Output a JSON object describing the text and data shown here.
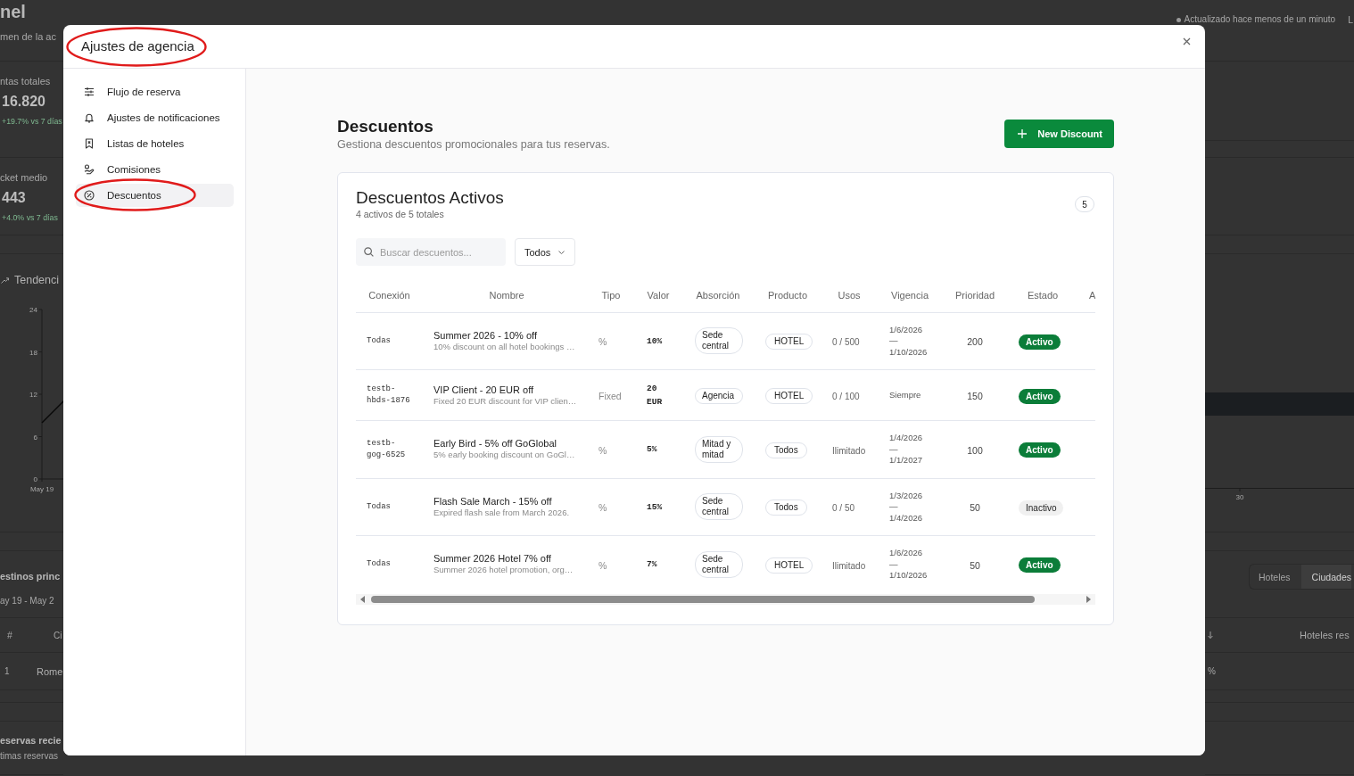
{
  "background": {
    "header": {
      "title": "nel",
      "subtitle": "men de la ac",
      "status": "Actualizado hace menos de un minuto",
      "cut_label": "L"
    },
    "stats": [
      {
        "label": "ntas totales",
        "value": "16.820",
        "change": "+19.7% vs 7 días"
      },
      {
        "label": "cket medio",
        "value": "443",
        "change": "+4.0% vs 7 días"
      }
    ],
    "trend": {
      "title": "Tendenci",
      "y_tick_labels": [
        "24",
        "18",
        "12",
        "6",
        "0"
      ],
      "x_tick_label": "May 19"
    },
    "side_chart": {
      "xtick_label": "30"
    },
    "destinations": {
      "title": "estinos princ",
      "range": "ay 19 - May 2",
      "tabs": [
        {
          "label": "Hoteles",
          "selected": false
        },
        {
          "label": "Ciudades",
          "selected": true
        }
      ],
      "columns": [
        "#",
        "Ci",
        "Hoteles res"
      ],
      "rows": [
        {
          "rank": "1",
          "city": "Rome",
          "share": "%"
        }
      ]
    },
    "recent": {
      "title": "eservas recie",
      "subtitle": "timas reservas"
    }
  },
  "modal": {
    "title": "Ajustes de agencia",
    "highlighted": true
  },
  "sidebar": {
    "items": [
      {
        "label": "Flujo de reserva",
        "selected": false,
        "highlighted": false
      },
      {
        "label": "Ajustes de notificaciones",
        "selected": false,
        "highlighted": false
      },
      {
        "label": "Listas de hoteles",
        "selected": false,
        "highlighted": false
      },
      {
        "label": "Comisiones",
        "selected": false,
        "highlighted": false
      },
      {
        "label": "Descuentos",
        "selected": true,
        "highlighted": true
      }
    ]
  },
  "discounts": {
    "title": "Descuentos",
    "subtitle": "Gestiona descuentos promocionales para tus reservas.",
    "new_button": "New Discount",
    "card": {
      "title": "Descuentos Activos",
      "summary": "4 activos de 5 totales",
      "count": "5",
      "search": {
        "placeholder": "Buscar descuentos..."
      },
      "filter": {
        "value": "Todos"
      },
      "table": {
        "columns": [
          "Conexión",
          "Nombre",
          "Tipo",
          "Valor",
          "Absorción",
          "Producto",
          "Usos",
          "Vigencia",
          "Prioridad",
          "Estado",
          "A"
        ],
        "rows": [
          {
            "connection": "Todas",
            "name": "Summer 2026 - 10% off",
            "description": "10% discount on all hotel bookings …",
            "type": "%",
            "value": "10%",
            "absorption": "Sede central",
            "product": "HOTEL",
            "uses": "0 / 500",
            "validity": "1/6/2026 — 1/10/2026",
            "priority": "200",
            "status": "Activo",
            "active": true
          },
          {
            "connection": "testb-hbds-1876",
            "name": "VIP Client - 20 EUR off",
            "description": "Fixed 20 EUR discount for VIP clien…",
            "type": "Fixed",
            "value": "20 EUR",
            "absorption": "Agencia",
            "product": "HOTEL",
            "uses": "0 / 100",
            "validity": "Siempre",
            "priority": "150",
            "status": "Activo",
            "active": true
          },
          {
            "connection": "testb-gog-6525",
            "name": "Early Bird - 5% off GoGlobal",
            "description": "5% early booking discount on GoGl…",
            "type": "%",
            "value": "5%",
            "absorption": "Mitad y mitad",
            "product": "Todos",
            "uses": "Ilimitado",
            "validity": "1/4/2026 — 1/1/2027",
            "priority": "100",
            "status": "Activo",
            "active": true
          },
          {
            "connection": "Todas",
            "name": "Flash Sale March - 15% off",
            "description": "Expired flash sale from March 2026.",
            "type": "%",
            "value": "15%",
            "absorption": "Sede central",
            "product": "Todos",
            "uses": "0 / 50",
            "validity": "1/3/2026 — 1/4/2026",
            "priority": "50",
            "status": "Inactivo",
            "active": false
          },
          {
            "connection": "Todas",
            "name": "Summer 2026 Hotel 7% off",
            "description": "Summer 2026 hotel promotion, org…",
            "type": "%",
            "value": "7%",
            "absorption": "Sede central",
            "product": "HOTEL",
            "uses": "Ilimitado",
            "validity": "1/6/2026 — 1/10/2026",
            "priority": "50",
            "status": "Activo",
            "active": true
          }
        ]
      }
    }
  }
}
